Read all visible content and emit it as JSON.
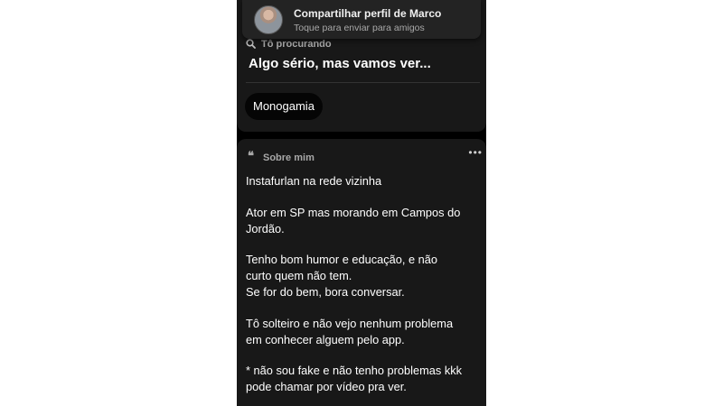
{
  "share_banner": {
    "title": "Compartilhar perfil de Marco",
    "subtitle": "Toque para enviar para amigos"
  },
  "looking_for": {
    "label": "Tô procurando",
    "value": "Algo sério, mas vamos ver...",
    "chip": "Monogamia"
  },
  "about": {
    "quote_glyph": "❝",
    "label": "Sobre mim",
    "more_glyph": "•••",
    "paragraphs": [
      "Instafurlan na rede vizinha",
      "Ator em SP mas morando em Campos do\nJordão.",
      "Tenho bom humor e educação, e não\ncurto quem não tem.\nSe for do bem, bora conversar.",
      "Tô solteiro e não vejo nenhum problema\nem conhecer alguem pelo app.",
      " * não sou fake e não tenho problemas kkk\npode chamar por vídeo pra ver."
    ]
  },
  "icons": {
    "avatar": "profile-photo",
    "search": "search-icon",
    "quote": "quote-icon",
    "more": "more-options-icon"
  },
  "colors": {
    "background": "#000000",
    "card": "#181818",
    "banner": "#232323",
    "text_primary": "#ffffff",
    "text_secondary": "#a8a8a8"
  }
}
